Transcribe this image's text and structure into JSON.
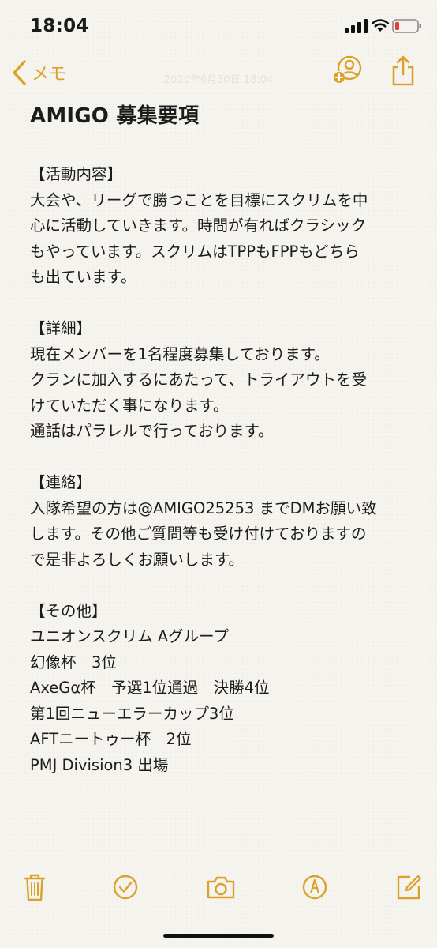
{
  "status_bar": {
    "time": "18:04"
  },
  "nav": {
    "back_label": "メモ",
    "date_faded": "2020年6月30日 18:04"
  },
  "note": {
    "title": "AMIGO 募集要項",
    "lines": [
      "【活動内容】",
      "大会や、リーグで勝つことを目標にスクリムを中",
      "心に活動していきます。時間が有ればクラシック",
      "もやっています。スクリムはTPPもFPPもどちら",
      "も出ています。",
      "",
      "【詳細】",
      "現在メンバーを1名程度募集しております。",
      "クランに加入するにあたって、トライアウトを受",
      "けていただく事になります。",
      "通話はパラレルで行っております。",
      "",
      "【連絡】",
      "入隊希望の方は@AMIGO25253 までDMお願い致",
      "します。その他ご質問等も受け付けておりますの",
      "で是非よろしくお願いします。",
      "",
      "【その他】",
      "ユニオンスクリム Aグループ",
      "幻像杯　3位",
      "AxeGα杯　予選1位通過　決勝4位",
      "第1回ニューエラーカップ3位",
      "AFTニートゥー杯　2位",
      "PMJ Division3 出場"
    ]
  },
  "icons": {
    "accent": "#dba22a",
    "toolbar": [
      "trash-icon",
      "checklist-icon",
      "camera-icon",
      "markup-icon",
      "compose-icon"
    ]
  }
}
